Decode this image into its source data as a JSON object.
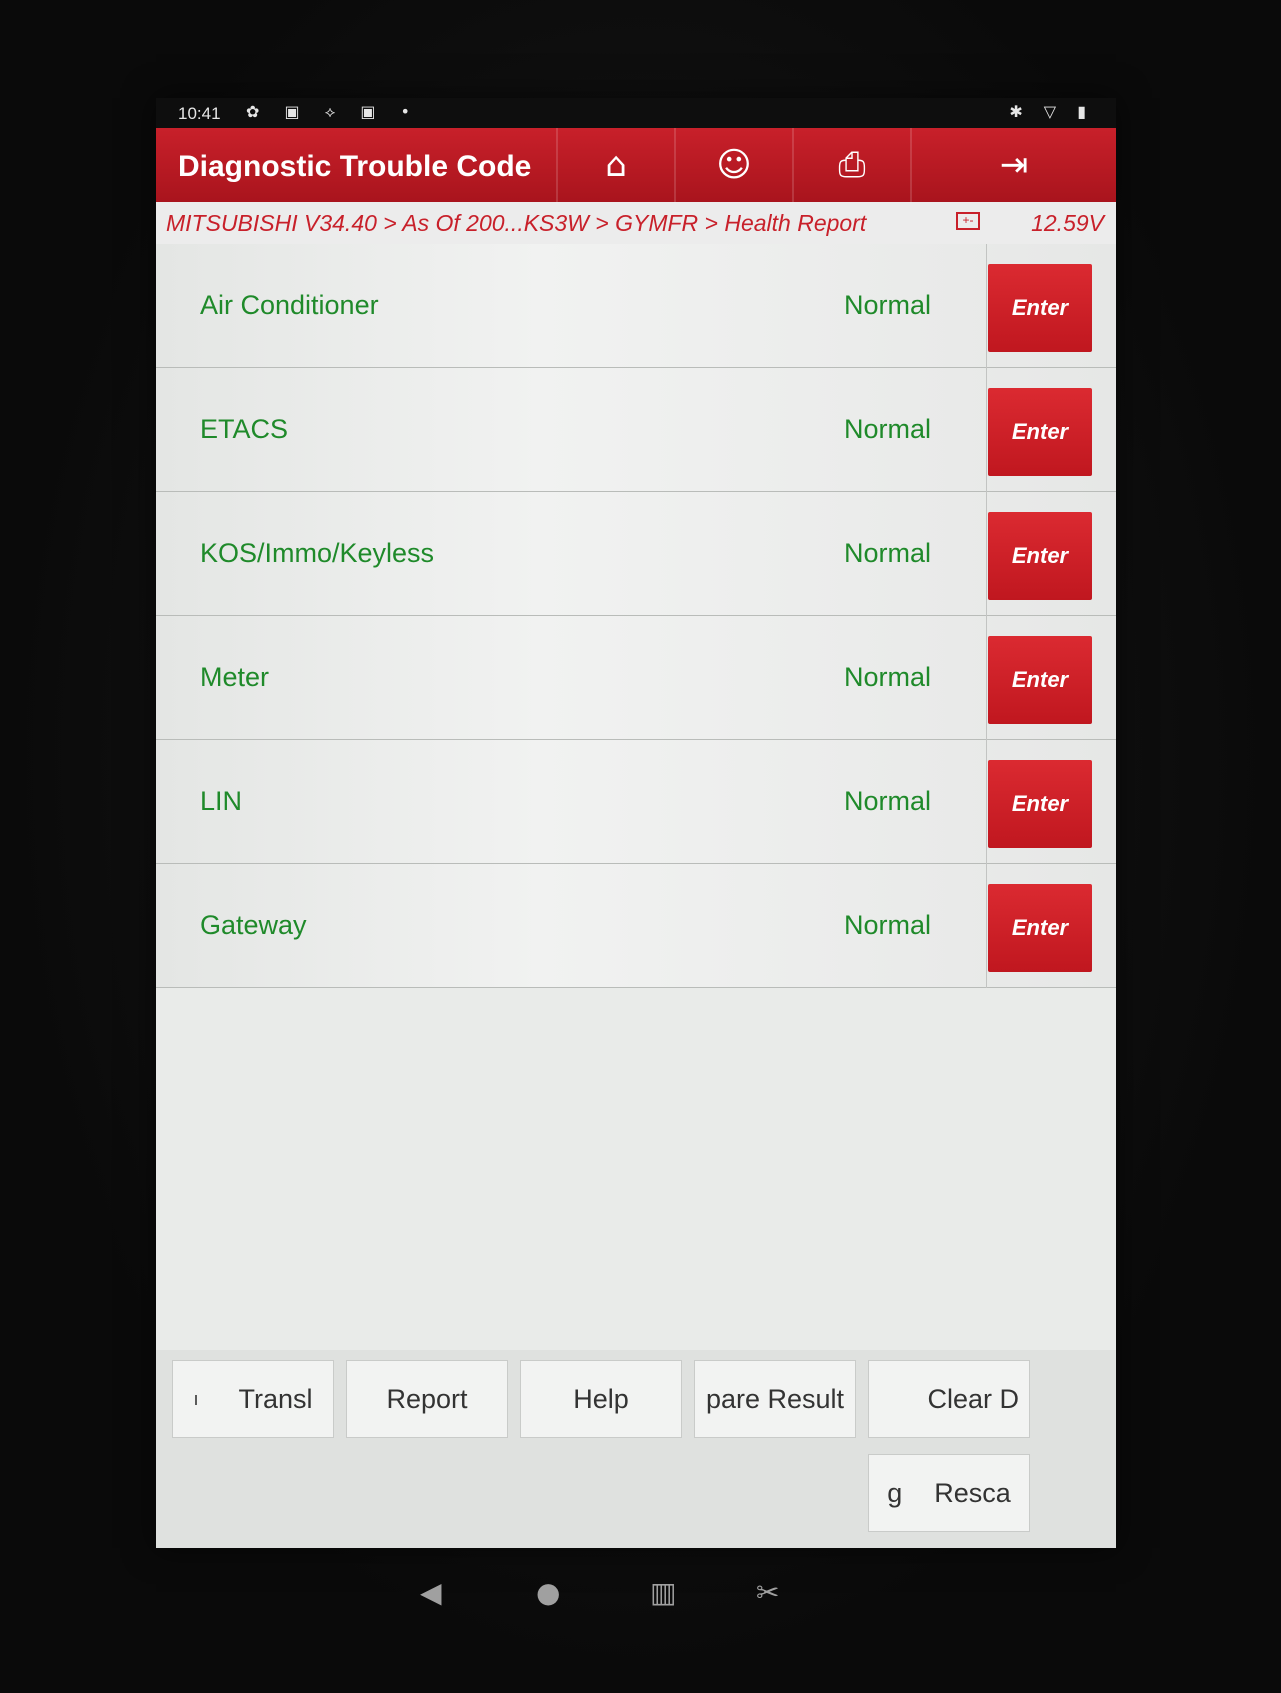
{
  "status_bar": {
    "time": "10:41",
    "left_icons": "✿ ▣ ⟡ ▣ •",
    "right_icons": "✱ ▽ ▮"
  },
  "header": {
    "title": "Diagnostic Trouble Code",
    "icons": [
      "home-icon",
      "user-support-icon",
      "print-icon",
      "exit-icon"
    ]
  },
  "breadcrumb": {
    "path": "MITSUBISHI V34.40 > As Of 200...KS3W > GYMFR > Health Report",
    "voltage": "12.59V"
  },
  "systems": [
    {
      "name": "Air Conditioner",
      "status": "Normal",
      "action": "Enter"
    },
    {
      "name": "ETACS",
      "status": "Normal",
      "action": "Enter"
    },
    {
      "name": "KOS/Immo/Keyless",
      "status": "Normal",
      "action": "Enter"
    },
    {
      "name": "Meter",
      "status": "Normal",
      "action": "Enter"
    },
    {
      "name": "LIN",
      "status": "Normal",
      "action": "Enter"
    },
    {
      "name": "Gateway",
      "status": "Normal",
      "action": "Enter"
    }
  ],
  "toolbar": {
    "translate": "Transl",
    "translate_prefix": "ı",
    "report": "Report",
    "help": "Help",
    "compare": "pare Result",
    "clear": "Clear D",
    "rescan_prefix": "g",
    "rescan": "Resca"
  },
  "colors": {
    "brand_red": "#c8202a",
    "status_green": "#1f8a2a"
  }
}
